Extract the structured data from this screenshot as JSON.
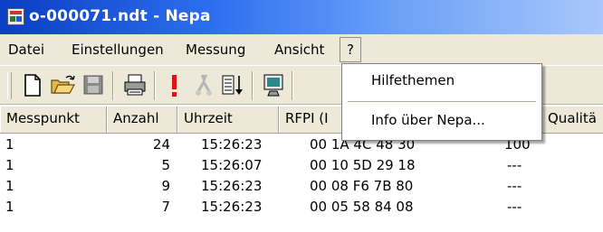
{
  "window": {
    "title": "o-000071.ndt - Nepa"
  },
  "menubar": {
    "items": [
      "Datei",
      "Einstellungen",
      "Messung",
      "Ansicht",
      "?"
    ]
  },
  "toolbar": {
    "icons": [
      "new-file-icon",
      "open-folder-icon",
      "save-icon",
      "print-icon",
      "alert-icon",
      "delete-icon",
      "sort-icon",
      "device-icon"
    ]
  },
  "help_menu": {
    "items": [
      "Hilfethemen",
      "Info über Nepa..."
    ]
  },
  "table": {
    "columns": [
      "Messpunkt",
      "Anzahl",
      "Uhrzeit",
      "RFPI (I",
      "Qualitä"
    ],
    "rows": [
      {
        "messpunkt": "1",
        "anzahl": "24",
        "uhrzeit": "15:26:23",
        "rfpi": "00 1A 4C 48 30",
        "qualitaet": "100"
      },
      {
        "messpunkt": "1",
        "anzahl": "5",
        "uhrzeit": "15:26:07",
        "rfpi": "00 10 5D 29 18",
        "qualitaet": "---"
      },
      {
        "messpunkt": "1",
        "anzahl": "9",
        "uhrzeit": "15:26:23",
        "rfpi": "00 08 F6 7B 80",
        "qualitaet": "---"
      },
      {
        "messpunkt": "1",
        "anzahl": "7",
        "uhrzeit": "15:26:23",
        "rfpi": "00 05 58 84 08",
        "qualitaet": "---"
      }
    ]
  },
  "colors": {
    "titlebar": "#0a3ec4",
    "chrome": "#ece9d8"
  }
}
